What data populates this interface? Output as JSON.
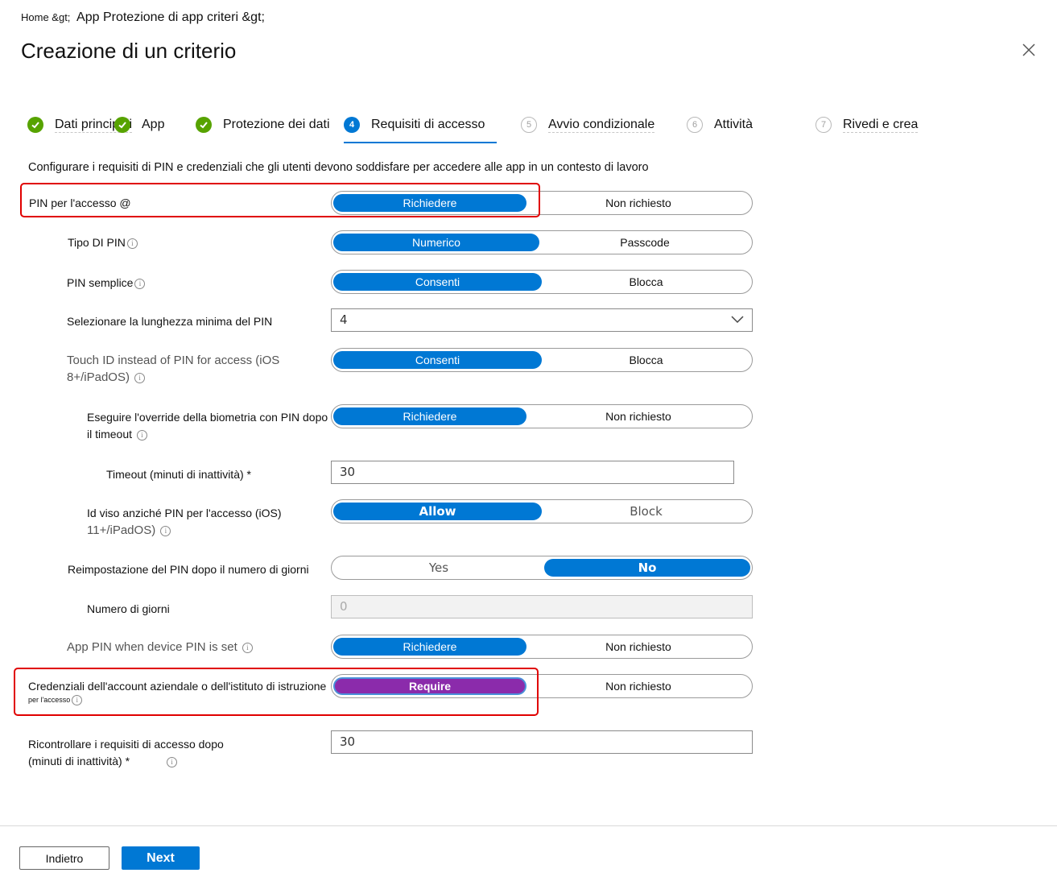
{
  "breadcrumb": {
    "home": "Home &gt;",
    "app": "App Protezione di app criteri &gt;"
  },
  "page_title": "Creazione di un criterio",
  "steps": [
    {
      "num": "✓",
      "label": "Dati principali",
      "state": "done"
    },
    {
      "num": "✓",
      "label": "App",
      "state": "done"
    },
    {
      "num": "✓",
      "label": "Protezione dei dati",
      "state": "done"
    },
    {
      "num": "4",
      "label": "Requisiti di accesso",
      "state": "current"
    },
    {
      "num": "5",
      "label": "Avvio condizionale",
      "state": "future"
    },
    {
      "num": "6",
      "label": "Attività",
      "state": "future"
    },
    {
      "num": "7",
      "label": "Rivedi e crea",
      "state": "future"
    }
  ],
  "intro": "Configurare i requisiti di PIN e credenziali che gli utenti devono soddisfare per accedere alle app in un contesto di lavoro",
  "info_glyph": "i",
  "fields": {
    "pin_access": {
      "label": "PIN per l'accesso @",
      "options": [
        "Richiedere",
        "Non richiesto"
      ],
      "selected": "Richiedere"
    },
    "pin_type": {
      "label": "Tipo DI PIN",
      "options": [
        "Numerico",
        "Passcode"
      ],
      "selected": "Numerico"
    },
    "simple_pin": {
      "label": "PIN semplice",
      "options": [
        "Consenti",
        "Blocca"
      ],
      "selected": "Consenti"
    },
    "min_length": {
      "label": "Selezionare la lunghezza minima del PIN",
      "value": "4"
    },
    "touch_id": {
      "label_line1": "Touch ID instead of PIN for access (iOS",
      "label_line2": "8+/iPadOS)",
      "options": [
        "Consenti",
        "Blocca"
      ],
      "selected": "Consenti"
    },
    "biometric_override": {
      "label_line1": "Eseguire l'override della biometria con PIN dopo",
      "label_line2": "il timeout",
      "options": [
        "Richiedere",
        "Non richiesto"
      ],
      "selected": "Richiedere"
    },
    "timeout": {
      "label": "Timeout (minuti di inattività) *",
      "value": "30"
    },
    "face_id": {
      "label_line1": "Id viso anziché PIN per l'accesso (iOS)",
      "label_line2": "11+/iPadOS)",
      "options": [
        "Allow",
        "Block"
      ],
      "selected": "Allow"
    },
    "pin_reset": {
      "label": "Reimpostazione del PIN dopo il numero di giorni",
      "options": [
        "Yes",
        "No"
      ],
      "selected": "No"
    },
    "days": {
      "label": "Numero di giorni",
      "value": "0"
    },
    "app_pin_device": {
      "label": "App PIN when device PIN is set",
      "options": [
        "Richiedere",
        "Non richiesto"
      ],
      "selected": "Richiedere"
    },
    "work_credentials": {
      "label_line1": "Credenziali dell'account aziendale o dell'istituto di istruzione",
      "label_line2": "per l'accesso",
      "options": [
        "Require",
        "Non richiesto"
      ],
      "selected": "Require"
    },
    "recheck": {
      "label_line1": "Ricontrollare i requisiti di accesso dopo",
      "label_line2": "(minuti di inattività) *",
      "value": "30"
    }
  },
  "footer": {
    "back": "Indietro",
    "next": "Next"
  },
  "colors": {
    "accent": "#0078d4",
    "done": "#57a300",
    "highlight": "#e00000",
    "purple": "#8b2bab"
  }
}
